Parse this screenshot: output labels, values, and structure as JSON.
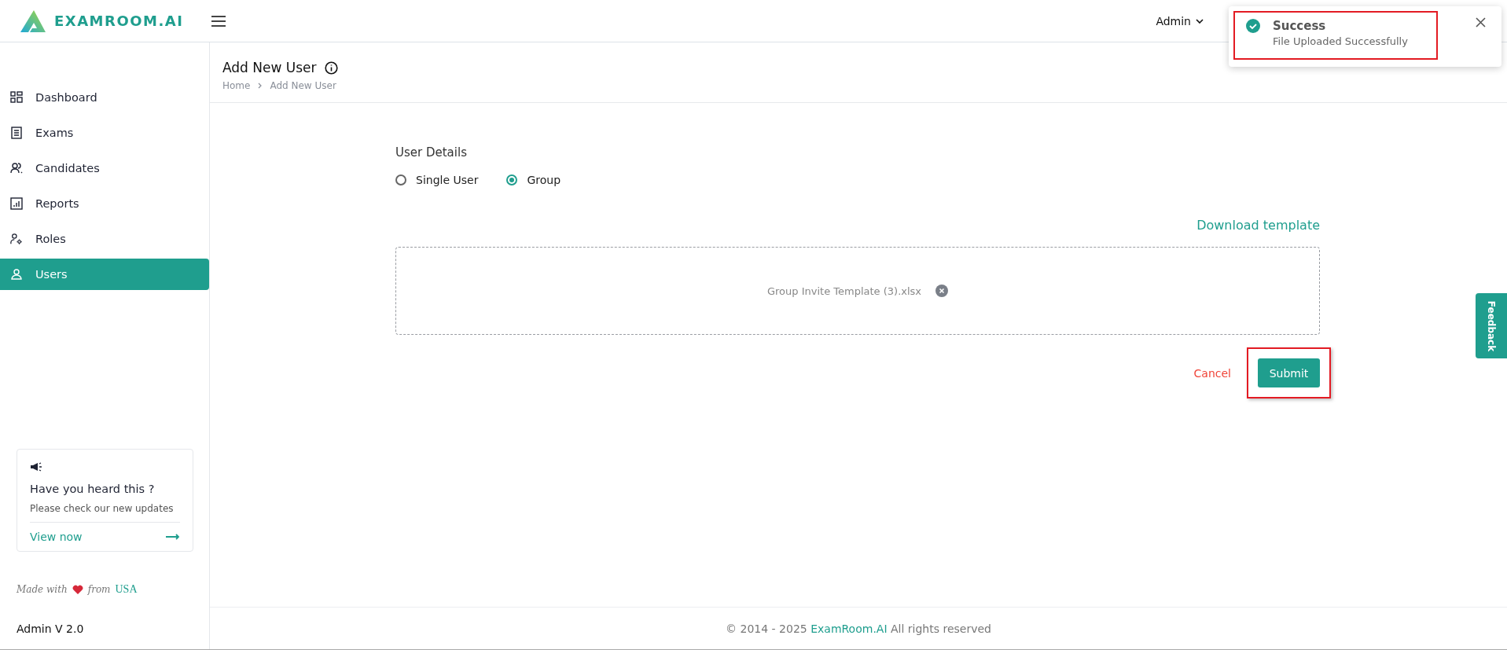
{
  "header": {
    "logo": "EXAMROOM.AI",
    "user_menu": "Admin"
  },
  "toast": {
    "title": "Success",
    "message": "File Uploaded Successfully",
    "highlighted": true
  },
  "sidebar": {
    "items": [
      {
        "label": "Dashboard",
        "kind": "dashboard",
        "selected": false
      },
      {
        "label": "Exams",
        "kind": "exams",
        "selected": false
      },
      {
        "label": "Candidates",
        "kind": "candidates",
        "selected": false
      },
      {
        "label": "Reports",
        "kind": "reports",
        "selected": false
      },
      {
        "label": "Roles",
        "kind": "roles",
        "selected": false
      },
      {
        "label": "Users",
        "kind": "users",
        "selected": true
      }
    ],
    "card": {
      "title": "Have you heard this ?",
      "text": "Please check our new updates",
      "link": "View now"
    },
    "made_with": {
      "before": "Made with",
      "after": "from",
      "country": "USA"
    },
    "version": "Admin V 2.0"
  },
  "page": {
    "title": "Add New User",
    "breadcrumb": [
      "Home",
      "Add New User"
    ]
  },
  "form": {
    "section": "User Details",
    "options": [
      {
        "label": "Single User",
        "selected": false
      },
      {
        "label": "Group",
        "selected": true
      }
    ],
    "download_link": "Download template",
    "file": "Group Invite Template (3).xlsx",
    "cancel": "Cancel",
    "submit": {
      "label": "Submit",
      "highlighted": true
    }
  },
  "feedback": "Feedback",
  "footer": {
    "prefix": "© 2014 - 2025 ",
    "link": "ExamRoom.AI",
    "suffix": " All rights reserved"
  }
}
